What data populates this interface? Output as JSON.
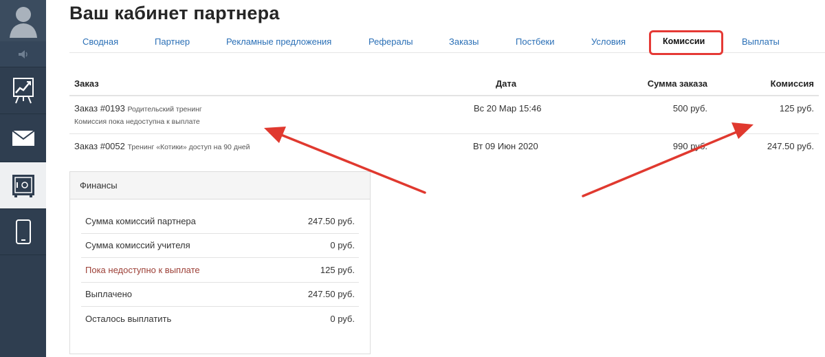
{
  "sidebar": {
    "items": [
      {
        "icon": "user-avatar-icon"
      },
      {
        "icon": "speaker-icon"
      },
      {
        "icon": "chart-board-icon"
      },
      {
        "icon": "mail-icon"
      },
      {
        "icon": "safe-icon"
      },
      {
        "icon": "phone-icon"
      }
    ]
  },
  "page": {
    "title": "Ваш кабинет партнера"
  },
  "tabs": [
    {
      "label": "Сводная"
    },
    {
      "label": "Партнер"
    },
    {
      "label": "Рекламные предложения"
    },
    {
      "label": "Рефералы"
    },
    {
      "label": "Заказы"
    },
    {
      "label": "Постбеки"
    },
    {
      "label": "Условия"
    },
    {
      "label": "Комиссии",
      "active": true
    },
    {
      "label": "Выплаты"
    }
  ],
  "table": {
    "headers": {
      "order": "Заказ",
      "date": "Дата",
      "amount": "Сумма заказа",
      "commission": "Комиссия"
    },
    "rows": [
      {
        "order": "Заказ #0193",
        "product": "Родительский тренинг",
        "note": "Комиссия пока недоступна к выплате",
        "date": "Вс 20 Мар 15:46",
        "amount": "500 руб.",
        "commission": "125 руб."
      },
      {
        "order": "Заказ #0052",
        "product": "Тренинг «Котики» доступ на 90 дней",
        "note": "",
        "date": "Вт 09 Июн 2020",
        "amount": "990 руб.",
        "commission": "247.50 руб."
      }
    ]
  },
  "finance": {
    "title": "Финансы",
    "rows": [
      {
        "label": "Сумма комиссий партнера",
        "value": "247.50 руб."
      },
      {
        "label": "Сумма комиссий учителя",
        "value": "0 руб."
      },
      {
        "label": "Пока недоступно к выплате",
        "value": "125 руб."
      },
      {
        "label": "Выплачено",
        "value": "247.50 руб."
      },
      {
        "label": "Осталось выплатить",
        "value": "0 руб."
      }
    ]
  },
  "colors": {
    "accent_link": "#2a6fb6",
    "highlight_red": "#e53935",
    "sidebar": "#2f3e50",
    "warn_text": "#9c3f36"
  }
}
